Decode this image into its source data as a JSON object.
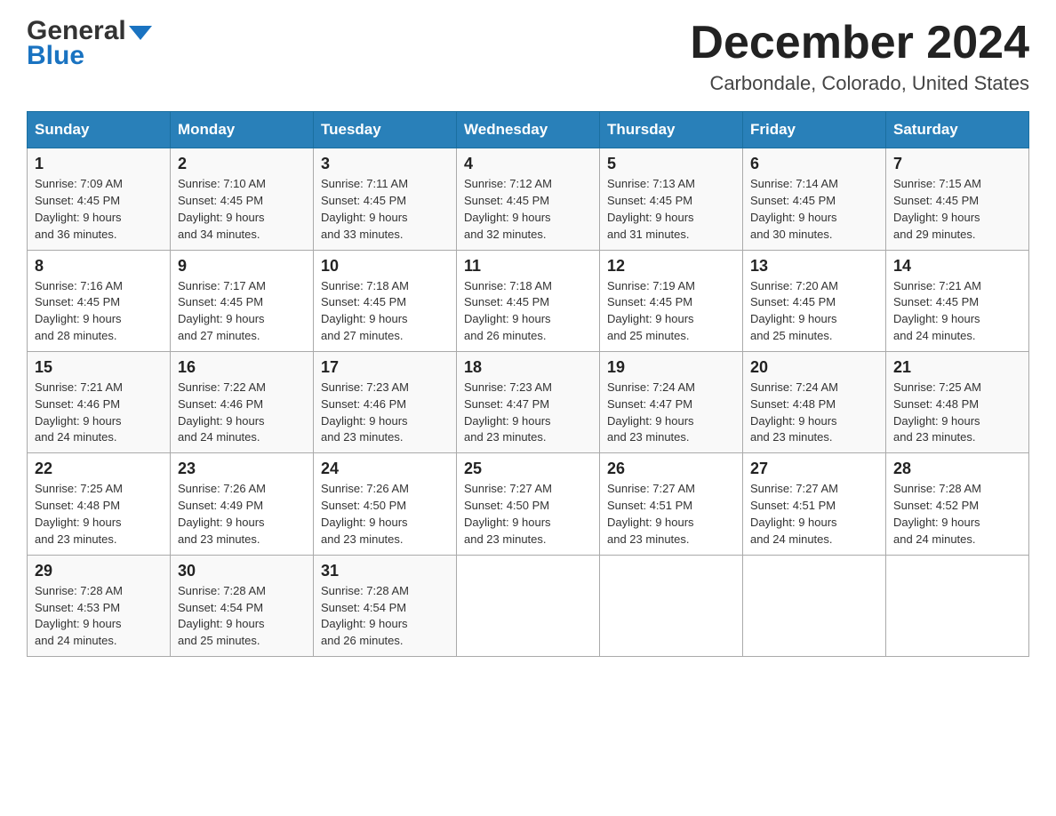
{
  "header": {
    "month_title": "December 2024",
    "location": "Carbondale, Colorado, United States",
    "logo_line1": "General",
    "logo_line2": "Blue"
  },
  "days_of_week": [
    "Sunday",
    "Monday",
    "Tuesday",
    "Wednesday",
    "Thursday",
    "Friday",
    "Saturday"
  ],
  "weeks": [
    [
      {
        "day": "1",
        "sunrise": "7:09 AM",
        "sunset": "4:45 PM",
        "daylight": "9 hours and 36 minutes."
      },
      {
        "day": "2",
        "sunrise": "7:10 AM",
        "sunset": "4:45 PM",
        "daylight": "9 hours and 34 minutes."
      },
      {
        "day": "3",
        "sunrise": "7:11 AM",
        "sunset": "4:45 PM",
        "daylight": "9 hours and 33 minutes."
      },
      {
        "day": "4",
        "sunrise": "7:12 AM",
        "sunset": "4:45 PM",
        "daylight": "9 hours and 32 minutes."
      },
      {
        "day": "5",
        "sunrise": "7:13 AM",
        "sunset": "4:45 PM",
        "daylight": "9 hours and 31 minutes."
      },
      {
        "day": "6",
        "sunrise": "7:14 AM",
        "sunset": "4:45 PM",
        "daylight": "9 hours and 30 minutes."
      },
      {
        "day": "7",
        "sunrise": "7:15 AM",
        "sunset": "4:45 PM",
        "daylight": "9 hours and 29 minutes."
      }
    ],
    [
      {
        "day": "8",
        "sunrise": "7:16 AM",
        "sunset": "4:45 PM",
        "daylight": "9 hours and 28 minutes."
      },
      {
        "day": "9",
        "sunrise": "7:17 AM",
        "sunset": "4:45 PM",
        "daylight": "9 hours and 27 minutes."
      },
      {
        "day": "10",
        "sunrise": "7:18 AM",
        "sunset": "4:45 PM",
        "daylight": "9 hours and 27 minutes."
      },
      {
        "day": "11",
        "sunrise": "7:18 AM",
        "sunset": "4:45 PM",
        "daylight": "9 hours and 26 minutes."
      },
      {
        "day": "12",
        "sunrise": "7:19 AM",
        "sunset": "4:45 PM",
        "daylight": "9 hours and 25 minutes."
      },
      {
        "day": "13",
        "sunrise": "7:20 AM",
        "sunset": "4:45 PM",
        "daylight": "9 hours and 25 minutes."
      },
      {
        "day": "14",
        "sunrise": "7:21 AM",
        "sunset": "4:45 PM",
        "daylight": "9 hours and 24 minutes."
      }
    ],
    [
      {
        "day": "15",
        "sunrise": "7:21 AM",
        "sunset": "4:46 PM",
        "daylight": "9 hours and 24 minutes."
      },
      {
        "day": "16",
        "sunrise": "7:22 AM",
        "sunset": "4:46 PM",
        "daylight": "9 hours and 24 minutes."
      },
      {
        "day": "17",
        "sunrise": "7:23 AM",
        "sunset": "4:46 PM",
        "daylight": "9 hours and 23 minutes."
      },
      {
        "day": "18",
        "sunrise": "7:23 AM",
        "sunset": "4:47 PM",
        "daylight": "9 hours and 23 minutes."
      },
      {
        "day": "19",
        "sunrise": "7:24 AM",
        "sunset": "4:47 PM",
        "daylight": "9 hours and 23 minutes."
      },
      {
        "day": "20",
        "sunrise": "7:24 AM",
        "sunset": "4:48 PM",
        "daylight": "9 hours and 23 minutes."
      },
      {
        "day": "21",
        "sunrise": "7:25 AM",
        "sunset": "4:48 PM",
        "daylight": "9 hours and 23 minutes."
      }
    ],
    [
      {
        "day": "22",
        "sunrise": "7:25 AM",
        "sunset": "4:48 PM",
        "daylight": "9 hours and 23 minutes."
      },
      {
        "day": "23",
        "sunrise": "7:26 AM",
        "sunset": "4:49 PM",
        "daylight": "9 hours and 23 minutes."
      },
      {
        "day": "24",
        "sunrise": "7:26 AM",
        "sunset": "4:50 PM",
        "daylight": "9 hours and 23 minutes."
      },
      {
        "day": "25",
        "sunrise": "7:27 AM",
        "sunset": "4:50 PM",
        "daylight": "9 hours and 23 minutes."
      },
      {
        "day": "26",
        "sunrise": "7:27 AM",
        "sunset": "4:51 PM",
        "daylight": "9 hours and 23 minutes."
      },
      {
        "day": "27",
        "sunrise": "7:27 AM",
        "sunset": "4:51 PM",
        "daylight": "9 hours and 24 minutes."
      },
      {
        "day": "28",
        "sunrise": "7:28 AM",
        "sunset": "4:52 PM",
        "daylight": "9 hours and 24 minutes."
      }
    ],
    [
      {
        "day": "29",
        "sunrise": "7:28 AM",
        "sunset": "4:53 PM",
        "daylight": "9 hours and 24 minutes."
      },
      {
        "day": "30",
        "sunrise": "7:28 AM",
        "sunset": "4:54 PM",
        "daylight": "9 hours and 25 minutes."
      },
      {
        "day": "31",
        "sunrise": "7:28 AM",
        "sunset": "4:54 PM",
        "daylight": "9 hours and 26 minutes."
      },
      null,
      null,
      null,
      null
    ]
  ],
  "labels": {
    "sunrise": "Sunrise:",
    "sunset": "Sunset:",
    "daylight": "Daylight:"
  }
}
